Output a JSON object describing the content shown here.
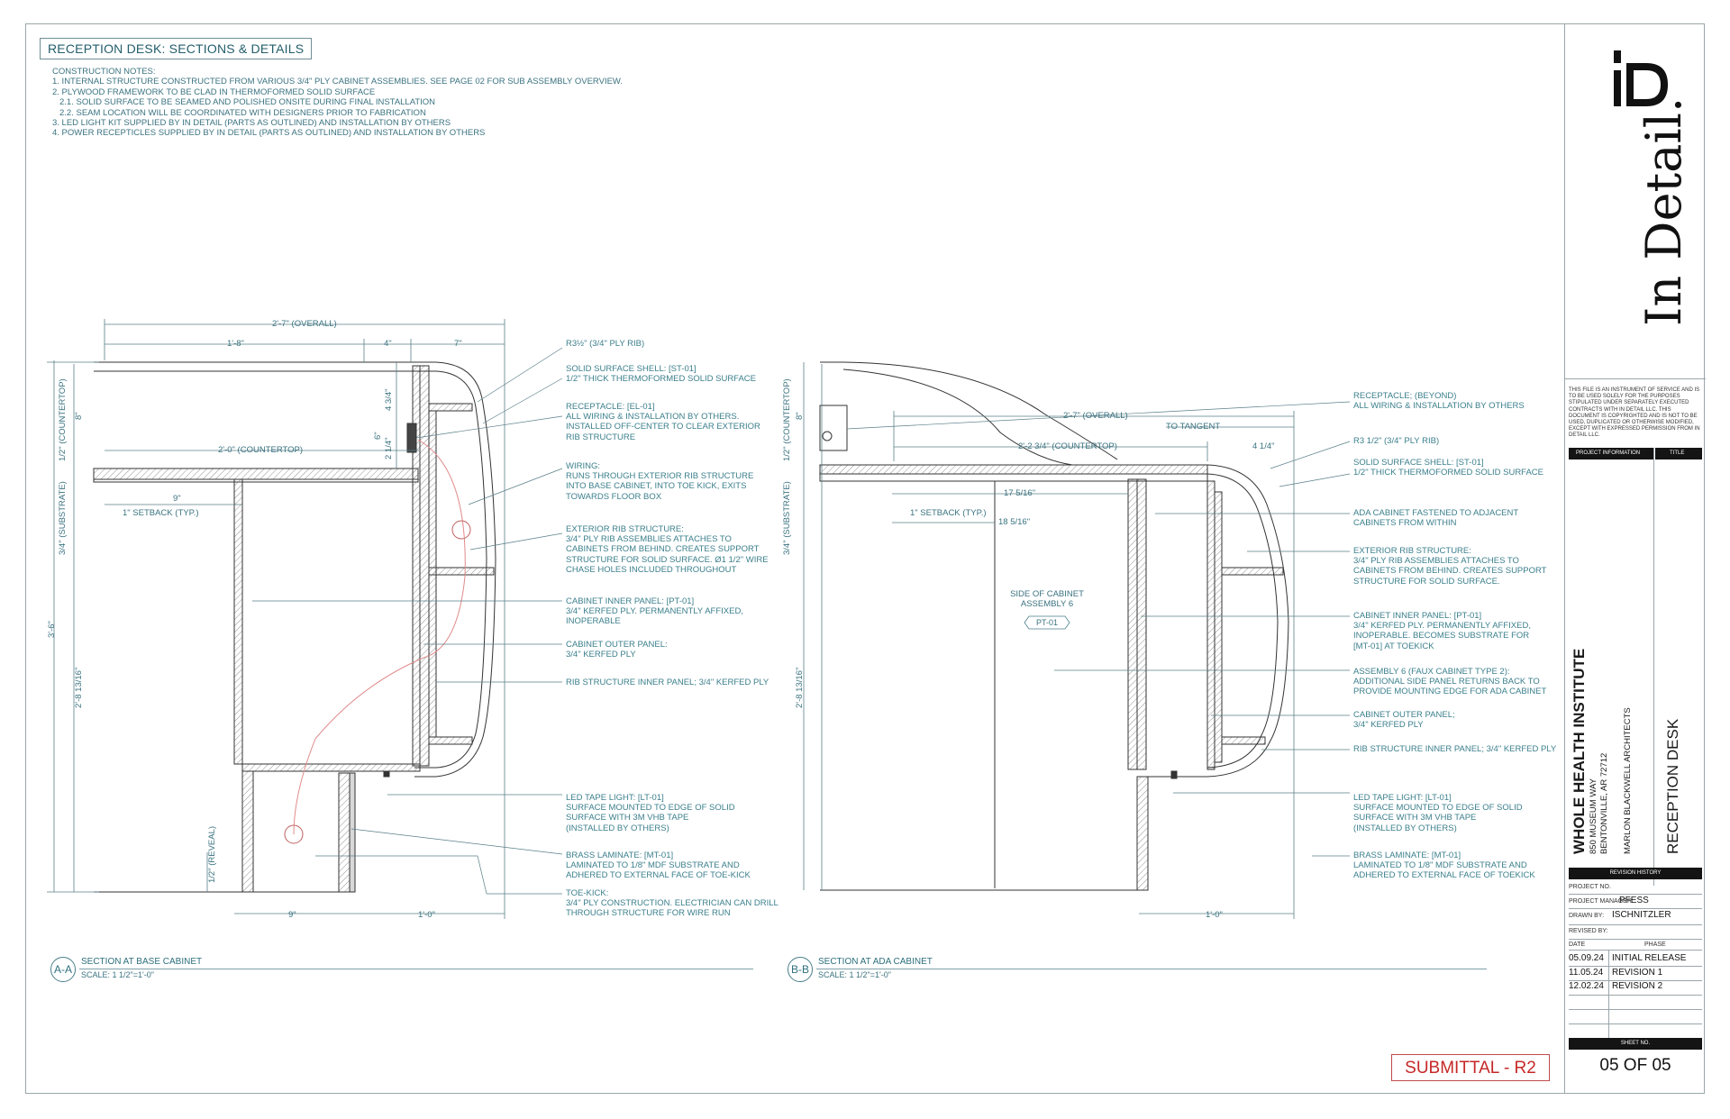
{
  "title": "RECEPTION DESK: SECTIONS & DETAILS",
  "construction_notes": {
    "heading": "CONSTRUCTION NOTES:",
    "items": [
      "1. INTERNAL STRUCTURE CONSTRUCTED FROM VARIOUS 3/4\" PLY CABINET ASSEMBLIES. SEE PAGE 02 FOR SUB ASSEMBLY OVERVIEW.",
      "2. PLYWOOD FRAMEWORK TO BE CLAD IN THERMOFORMED SOLID SURFACE",
      "2.1. SOLID SURFACE TO BE SEAMED AND POLISHED ONSITE DURING FINAL INSTALLATION",
      "2.2. SEAM LOCATION WILL BE COORDINATED WITH DESIGNERS PRIOR TO FABRICATION",
      "3. LED LIGHT KIT SUPPLIED BY IN DETAIL (PARTS AS OUTLINED) AND INSTALLATION BY OTHERS",
      "4. POWER RECEPTICLES SUPPLIED BY IN DETAIL (PARTS AS OUTLINED) AND INSTALLATION BY OTHERS"
    ]
  },
  "section_a": {
    "tag": "A-A",
    "title": "SECTION AT BASE CABINET",
    "scale": "SCALE: 1 1/2\"=1'-0\"",
    "dims": {
      "overall": "2'-7\" (OVERALL)",
      "d1": "1'-8\"",
      "d2": "4\"",
      "d3": "7\"",
      "countertop": "2'-0\" (COUNTERTOP)",
      "nine": "9\"",
      "setback": "1\" SETBACK (TYP.)",
      "bottom_nine": "9\"",
      "bottom_one": "1'-0\"",
      "v_countertop": "1/2\" (COUNTERTOP)",
      "v_substrate": "3/4\" (SUBSTRATE)",
      "v_eight": "8\"",
      "v_total": "3'-6\"",
      "v_lower": "2'-8 13/16\"",
      "v_reveal": "1/2\" (REVEAL)",
      "v_434": "4 3/4\"",
      "v_214": "2 1/4\"",
      "v_6": "6\""
    },
    "callouts": [
      "R3½\" (3/4\" PLY RIB)",
      "SOLID SURFACE SHELL: [ST-01]\n1/2\" THICK THERMOFORMED SOLID SURFACE",
      "RECEPTACLE: [EL-01]\nALL WIRING & INSTALLATION BY OTHERS.\nINSTALLED OFF-CENTER TO CLEAR EXTERIOR\nRIB STRUCTURE",
      "WIRING:\nRUNS THROUGH EXTERIOR RIB STRUCTURE\nINTO BASE CABINET, INTO TOE KICK, EXITS\nTOWARDS FLOOR BOX",
      "EXTERIOR RIB STRUCTURE:\n3/4\" PLY RIB ASSEMBLIES ATTACHES TO\nCABINETS FROM BEHIND. CREATES SUPPORT\nSTRUCTURE FOR SOLID SURFACE. Ø1 1/2\" WIRE\nCHASE HOLES INCLUDED THROUGHOUT",
      "CABINET INNER PANEL: [PT-01]\n3/4\" KERFED PLY. PERMANENTLY AFFIXED,\nINOPERABLE",
      "CABINET OUTER PANEL:\n3/4\" KERFED PLY",
      "RIB STRUCTURE INNER PANEL; 3/4\" KERFED PLY",
      "LED TAPE LIGHT: [LT-01]\nSURFACE MOUNTED TO EDGE OF SOLID\nSURFACE WITH 3M VHB TAPE\n(INSTALLED BY OTHERS)",
      "BRASS LAMINATE: [MT-01]\nLAMINATED TO 1/8\" MDF SUBSTRATE AND\nADHERED TO EXTERNAL FACE OF TOE-KICK",
      "TOE-KICK:\n3/4\" PLY CONSTRUCTION. ELECTRICIAN CAN DRILL\nTHROUGH STRUCTURE FOR WIRE RUN"
    ]
  },
  "section_b": {
    "tag": "B-B",
    "title": "SECTION AT ADA CABINET",
    "scale": "SCALE: 1 1/2\"=1'-0\"",
    "dims": {
      "overall": "2'-7\" (OVERALL)",
      "tangent": "TO TANGENT",
      "countertop": "2'-2 3/4\" (COUNTERTOP)",
      "four_quarter": "4 1/4\"",
      "d_17": "17 5/16\"",
      "d_18": "18 5/16\"",
      "setback": "1\" SETBACK (TYP.)",
      "bottom_one": "1'-0\"",
      "v_countertop": "1/2\" (COUNTERTOP)",
      "v_substrate": "3/4\" (SUBSTRATE)",
      "v_eight": "8\"",
      "v_lower": "2'-8 13/16\""
    },
    "side_label": "SIDE OF CABINET\nASSEMBLY 6",
    "pt_tag": "PT-01",
    "callouts": [
      "RECEPTACLE; (BEYOND)\nALL WIRING & INSTALLATION BY OTHERS",
      "R3 1/2\" (3/4\" PLY RIB)",
      "SOLID SURFACE SHELL: [ST-01]\n1/2\" THICK THERMOFORMED SOLID SURFACE",
      "ADA CABINET FASTENED TO ADJACENT\nCABINETS FROM WITHIN",
      "EXTERIOR RIB STRUCTURE:\n3/4\" PLY RIB ASSEMBLIES ATTACHES TO\nCABINETS FROM BEHIND. CREATES SUPPORT\nSTRUCTURE FOR SOLID SURFACE.",
      "CABINET INNER PANEL: [PT-01]\n3/4\" KERFED PLY. PERMANENTLY AFFIXED,\nINOPERABLE. BECOMES SUBSTRATE FOR\n[MT-01] AT TOEKICK",
      "ASSEMBLY 6 (FAUX CABINET TYPE 2):\nADDITIONAL SIDE PANEL RETURNS BACK TO\nPROVIDE MOUNTING EDGE FOR ADA CABINET",
      "CABINET OUTER PANEL;\n3/4\" KERFED PLY",
      "RIB STRUCTURE INNER PANEL; 3/4\" KERFED PLY",
      "LED TAPE LIGHT: [LT-01]\nSURFACE MOUNTED TO EDGE OF SOLID\nSURFACE WITH 3M VHB TAPE\n(INSTALLED BY OTHERS)",
      "BRASS LAMINATE: [MT-01]\nLAMINATED TO 1/8\" MDF SUBSTRATE AND\nADHERED TO EXTERNAL FACE OF TOEKICK"
    ]
  },
  "submittal": "SUBMITTAL - R2",
  "title_block": {
    "logo": "In Detail.",
    "legal": "THIS FILE IS AN INSTRUMENT OF SERVICE AND IS TO BE USED SOLELY FOR THE PURPOSES STIPULATED UNDER SEPARATELY EXECUTED CONTRACTS WITH IN DETAIL LLC. THIS DOCUMENT IS COPYRIGHTED AND IS NOT TO BE USED, DUPLICATED OR OTHERWISE MODIFIED, EXCEPT WITH EXPRESSED PERMISSION FROM IN DETAIL LLC.",
    "project_information": "PROJECT INFORMATION",
    "title_label": "TITLE",
    "client": "WHOLE HEALTH INSTITUTE",
    "address1": "850 MUSEUM WAY",
    "address2": "BENTONVILLE, AR 72712",
    "architect": "MARLON BLACKWELL ARCHITECTS",
    "sheet_title": "RECEPTION DESK",
    "revision_history": "REVISION HISTORY",
    "project_no_label": "PROJECT NO.",
    "project_manager_label": "PROJECT MANAGER:",
    "project_manager": "PFESS",
    "drawn_by_label": "DRAWN BY:",
    "drawn_by": "ISCHNITZLER",
    "revised_by_label": "REVISED BY:",
    "date_label": "DATE",
    "phase_label": "PHASE",
    "revisions": [
      {
        "date": "05.09.24",
        "phase": "INITIAL RELEASE"
      },
      {
        "date": "11.05.24",
        "phase": "REVISION 1"
      },
      {
        "date": "12.02.24",
        "phase": "REVISION 2"
      }
    ],
    "sheet_no_label": "SHEET NO.",
    "sheet_no": "05 OF 05"
  }
}
